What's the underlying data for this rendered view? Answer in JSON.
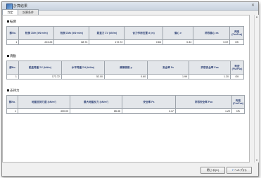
{
  "window": {
    "title": "計算結果"
  },
  "tabs": [
    {
      "label": "判定"
    },
    {
      "label": "計算条件"
    }
  ],
  "sections": [
    {
      "title": "転倒",
      "columns": [
        "部No.",
        "転倒 ΣMe (kN·m/m)",
        "転倒 ΣMo (kN·m/m)",
        "鉛直力 ΣV (kN/m)",
        "合力作用位置 d (m)",
        "偏心 e",
        "許容偏心 ea",
        "判定 (Fs≥Fsa)"
      ],
      "rows": [
        [
          "1",
          "223.25",
          "88.74",
          "172.72",
          "0.66",
          "0.34",
          "0.67",
          "OK"
        ]
      ]
    },
    {
      "title": "滑動",
      "columns": [
        "部No.",
        "鉛直荷重 ΣV (kN/m)",
        "水平荷重 ΣH (kN/m)",
        "摩擦係数 μ",
        "安全率 Fs",
        "許容安全率 Fsa",
        "判定 (Fs≥Fsa)"
      ],
      "rows": [
        [
          "1",
          "172.72",
          "52.00",
          "0.60",
          "1.99",
          "1.20",
          "OK"
        ]
      ]
    },
    {
      "title": "支持力",
      "columns": [
        "部No.",
        "地盤支持力度 (kN/m²)",
        "最大地盤反力 (kN/m²)",
        "安全率 Fs",
        "許容安全率 Fsa",
        "判定 (Fs≥Fsa)"
      ],
      "rows": [
        [
          "1",
          "300.00",
          "86.36",
          "3.47",
          "1.20",
          "OK"
        ]
      ]
    }
  ],
  "buttons": {
    "close": "閉じる(C)",
    "help": "ヘルプ(H)"
  }
}
